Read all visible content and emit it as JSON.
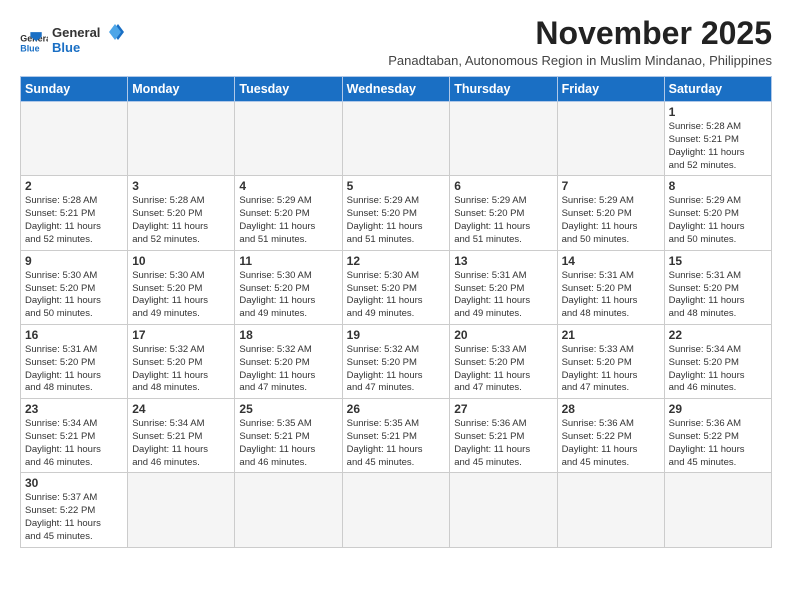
{
  "header": {
    "logo_general": "General",
    "logo_blue": "Blue",
    "month_title": "November 2025",
    "subtitle": "Panadtaban, Autonomous Region in Muslim Mindanao, Philippines"
  },
  "weekdays": [
    "Sunday",
    "Monday",
    "Tuesday",
    "Wednesday",
    "Thursday",
    "Friday",
    "Saturday"
  ],
  "weeks": [
    [
      {
        "day": null,
        "info": ""
      },
      {
        "day": null,
        "info": ""
      },
      {
        "day": null,
        "info": ""
      },
      {
        "day": null,
        "info": ""
      },
      {
        "day": null,
        "info": ""
      },
      {
        "day": null,
        "info": ""
      },
      {
        "day": "1",
        "info": "Sunrise: 5:28 AM\nSunset: 5:21 PM\nDaylight: 11 hours\nand 52 minutes."
      }
    ],
    [
      {
        "day": "2",
        "info": "Sunrise: 5:28 AM\nSunset: 5:21 PM\nDaylight: 11 hours\nand 52 minutes."
      },
      {
        "day": "3",
        "info": "Sunrise: 5:28 AM\nSunset: 5:20 PM\nDaylight: 11 hours\nand 52 minutes."
      },
      {
        "day": "4",
        "info": "Sunrise: 5:29 AM\nSunset: 5:20 PM\nDaylight: 11 hours\nand 51 minutes."
      },
      {
        "day": "5",
        "info": "Sunrise: 5:29 AM\nSunset: 5:20 PM\nDaylight: 11 hours\nand 51 minutes."
      },
      {
        "day": "6",
        "info": "Sunrise: 5:29 AM\nSunset: 5:20 PM\nDaylight: 11 hours\nand 51 minutes."
      },
      {
        "day": "7",
        "info": "Sunrise: 5:29 AM\nSunset: 5:20 PM\nDaylight: 11 hours\nand 50 minutes."
      },
      {
        "day": "8",
        "info": "Sunrise: 5:29 AM\nSunset: 5:20 PM\nDaylight: 11 hours\nand 50 minutes."
      }
    ],
    [
      {
        "day": "9",
        "info": "Sunrise: 5:30 AM\nSunset: 5:20 PM\nDaylight: 11 hours\nand 50 minutes."
      },
      {
        "day": "10",
        "info": "Sunrise: 5:30 AM\nSunset: 5:20 PM\nDaylight: 11 hours\nand 49 minutes."
      },
      {
        "day": "11",
        "info": "Sunrise: 5:30 AM\nSunset: 5:20 PM\nDaylight: 11 hours\nand 49 minutes."
      },
      {
        "day": "12",
        "info": "Sunrise: 5:30 AM\nSunset: 5:20 PM\nDaylight: 11 hours\nand 49 minutes."
      },
      {
        "day": "13",
        "info": "Sunrise: 5:31 AM\nSunset: 5:20 PM\nDaylight: 11 hours\nand 49 minutes."
      },
      {
        "day": "14",
        "info": "Sunrise: 5:31 AM\nSunset: 5:20 PM\nDaylight: 11 hours\nand 48 minutes."
      },
      {
        "day": "15",
        "info": "Sunrise: 5:31 AM\nSunset: 5:20 PM\nDaylight: 11 hours\nand 48 minutes."
      }
    ],
    [
      {
        "day": "16",
        "info": "Sunrise: 5:31 AM\nSunset: 5:20 PM\nDaylight: 11 hours\nand 48 minutes."
      },
      {
        "day": "17",
        "info": "Sunrise: 5:32 AM\nSunset: 5:20 PM\nDaylight: 11 hours\nand 48 minutes."
      },
      {
        "day": "18",
        "info": "Sunrise: 5:32 AM\nSunset: 5:20 PM\nDaylight: 11 hours\nand 47 minutes."
      },
      {
        "day": "19",
        "info": "Sunrise: 5:32 AM\nSunset: 5:20 PM\nDaylight: 11 hours\nand 47 minutes."
      },
      {
        "day": "20",
        "info": "Sunrise: 5:33 AM\nSunset: 5:20 PM\nDaylight: 11 hours\nand 47 minutes."
      },
      {
        "day": "21",
        "info": "Sunrise: 5:33 AM\nSunset: 5:20 PM\nDaylight: 11 hours\nand 47 minutes."
      },
      {
        "day": "22",
        "info": "Sunrise: 5:34 AM\nSunset: 5:20 PM\nDaylight: 11 hours\nand 46 minutes."
      }
    ],
    [
      {
        "day": "23",
        "info": "Sunrise: 5:34 AM\nSunset: 5:21 PM\nDaylight: 11 hours\nand 46 minutes."
      },
      {
        "day": "24",
        "info": "Sunrise: 5:34 AM\nSunset: 5:21 PM\nDaylight: 11 hours\nand 46 minutes."
      },
      {
        "day": "25",
        "info": "Sunrise: 5:35 AM\nSunset: 5:21 PM\nDaylight: 11 hours\nand 46 minutes."
      },
      {
        "day": "26",
        "info": "Sunrise: 5:35 AM\nSunset: 5:21 PM\nDaylight: 11 hours\nand 45 minutes."
      },
      {
        "day": "27",
        "info": "Sunrise: 5:36 AM\nSunset: 5:21 PM\nDaylight: 11 hours\nand 45 minutes."
      },
      {
        "day": "28",
        "info": "Sunrise: 5:36 AM\nSunset: 5:22 PM\nDaylight: 11 hours\nand 45 minutes."
      },
      {
        "day": "29",
        "info": "Sunrise: 5:36 AM\nSunset: 5:22 PM\nDaylight: 11 hours\nand 45 minutes."
      }
    ],
    [
      {
        "day": "30",
        "info": "Sunrise: 5:37 AM\nSunset: 5:22 PM\nDaylight: 11 hours\nand 45 minutes."
      },
      {
        "day": null,
        "info": ""
      },
      {
        "day": null,
        "info": ""
      },
      {
        "day": null,
        "info": ""
      },
      {
        "day": null,
        "info": ""
      },
      {
        "day": null,
        "info": ""
      },
      {
        "day": null,
        "info": ""
      }
    ]
  ]
}
